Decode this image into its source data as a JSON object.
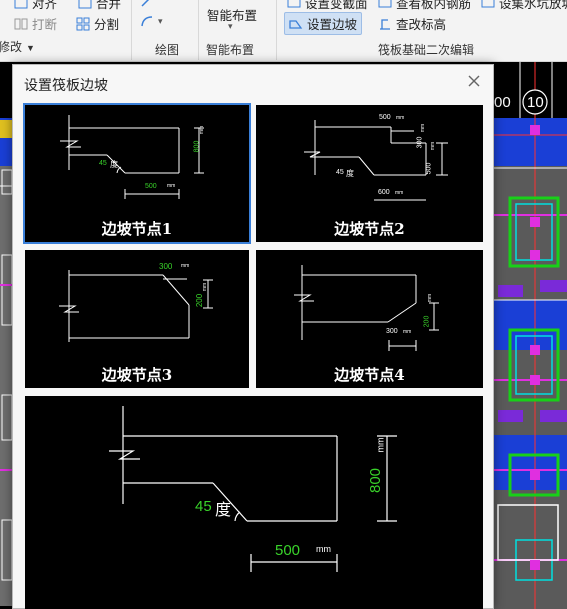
{
  "ribbon": {
    "align_label": "对齐",
    "merge_label": "合并",
    "break_label": "打断",
    "split_label": "分割",
    "modify_label": "修改",
    "smart_layout_label": "智能布置",
    "set_section_label": "设置变截面",
    "view_rebar_label": "查看板内钢筋",
    "set_slope_label": "设置边坡",
    "edit_elevation_label": "查改标高",
    "set_node_label": "设集水坑放坡",
    "group_draw": "绘图",
    "group_smart": "智能布置",
    "group_raft": "筏板基础二次编辑"
  },
  "dialog": {
    "title": "设置筏板边坡",
    "thumbnails": [
      {
        "label": "边坡节点1",
        "selected": true,
        "texts": {
          "angle_num": "45",
          "angle_unit": "度",
          "h": "800",
          "h_unit": "mm",
          "w": "500",
          "w_unit": "mm"
        }
      },
      {
        "label": "边坡节点2",
        "selected": false,
        "texts": {
          "top_w": "500",
          "top_unit": "mm",
          "h1": "300",
          "h1_unit": "mm",
          "h2": "500",
          "h2_unit": "mm",
          "angle_num": "45",
          "angle_unit": "度",
          "w": "600",
          "w_unit": "mm"
        }
      },
      {
        "label": "边坡节点3",
        "selected": false,
        "texts": {
          "w": "300",
          "w_unit": "mm",
          "h": "200",
          "h_unit": "mm"
        }
      },
      {
        "label": "边坡节点4",
        "selected": false,
        "texts": {
          "w": "300",
          "w_unit": "mm",
          "h": "200",
          "h_unit": "mm"
        }
      }
    ],
    "preview": {
      "angle_num": "45",
      "angle_unit": "度",
      "h": "800",
      "h_unit": "mm",
      "w": "500",
      "w_unit": "mm"
    }
  },
  "cad": {
    "axis_label": "10",
    "axis_label_partial": "00"
  },
  "colors": {
    "accent_green": "#39d32a",
    "cad_blue": "#1a3fd6",
    "cad_magenta": "#e02fe0",
    "cad_cyan": "#00e0e0",
    "select_blue": "#3a7fd8"
  }
}
